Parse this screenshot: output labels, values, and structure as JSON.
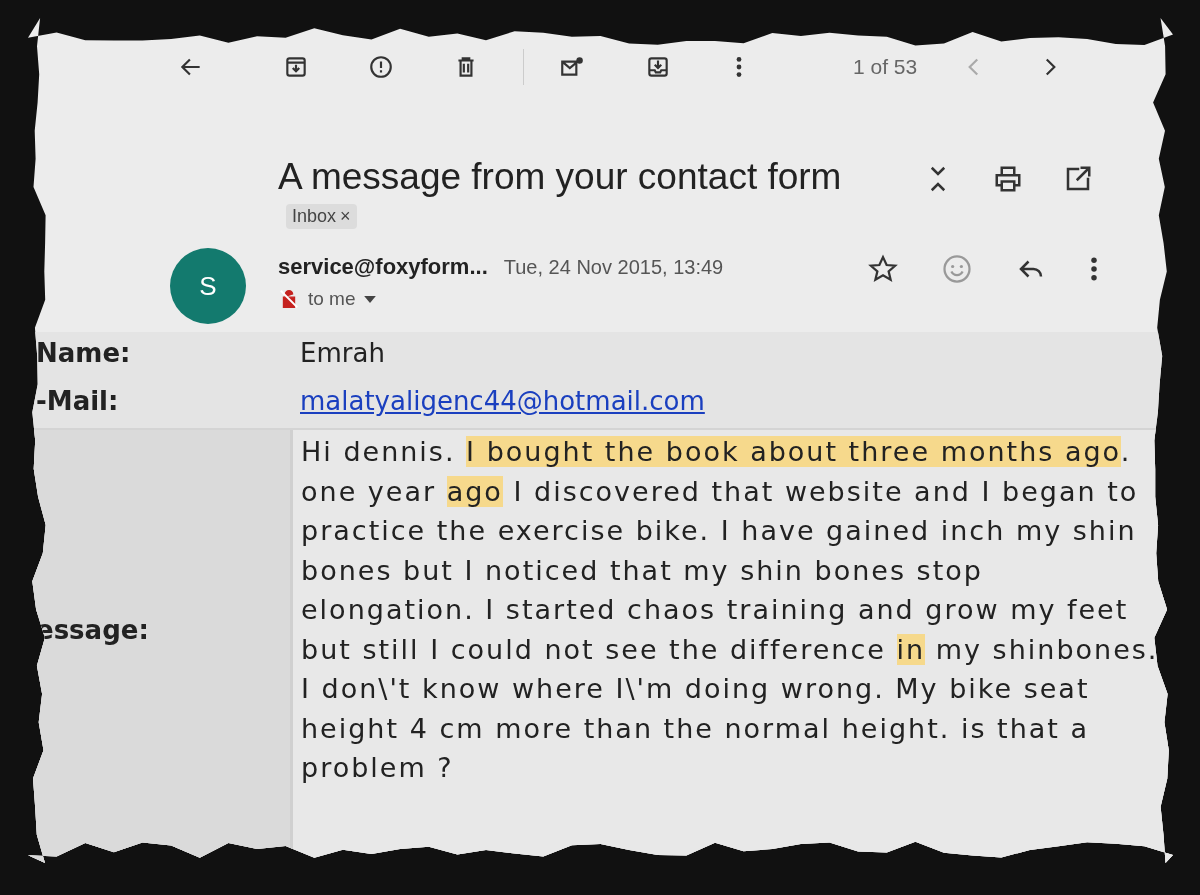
{
  "toolbar": {
    "page_count": "1 of 53"
  },
  "subject": {
    "title": "A message from your contact form",
    "label": "Inbox",
    "label_close": "×"
  },
  "sender": {
    "avatar_letter": "S",
    "address": "service@foxyform...",
    "date": "Tue, 24 Nov 2015, 13:49",
    "recipient": "to me",
    "starred": false
  },
  "form_rows": [
    {
      "label": "Name:",
      "kind": "text",
      "value": "Emrah"
    },
    {
      "label": "-Mail:",
      "kind": "link",
      "value": "malatyaligenc44@hotmail.com"
    },
    {
      "label": "essage:",
      "kind": "message",
      "segments": [
        {
          "text": "Hi dennis. ",
          "highlighted": false
        },
        {
          "text": "I bought the book about three months ago",
          "highlighted": true
        },
        {
          "text": ". one year ",
          "highlighted": false
        },
        {
          "text": "ago",
          "highlighted": true
        },
        {
          "text": " I discovered that website and I began to practice the exercise bike. I have gained inch my shin bones but I noticed that my shin bones stop elongation. I started chaos training and grow my feet but still I could not see the difference ",
          "highlighted": false
        },
        {
          "text": "in",
          "highlighted": true
        },
        {
          "text": " my shinbones. I don\\'t know where I\\'m doing wrong. My bike seat height 4 cm more than the normal height. is that a problem ?",
          "highlighted": false
        }
      ]
    }
  ]
}
